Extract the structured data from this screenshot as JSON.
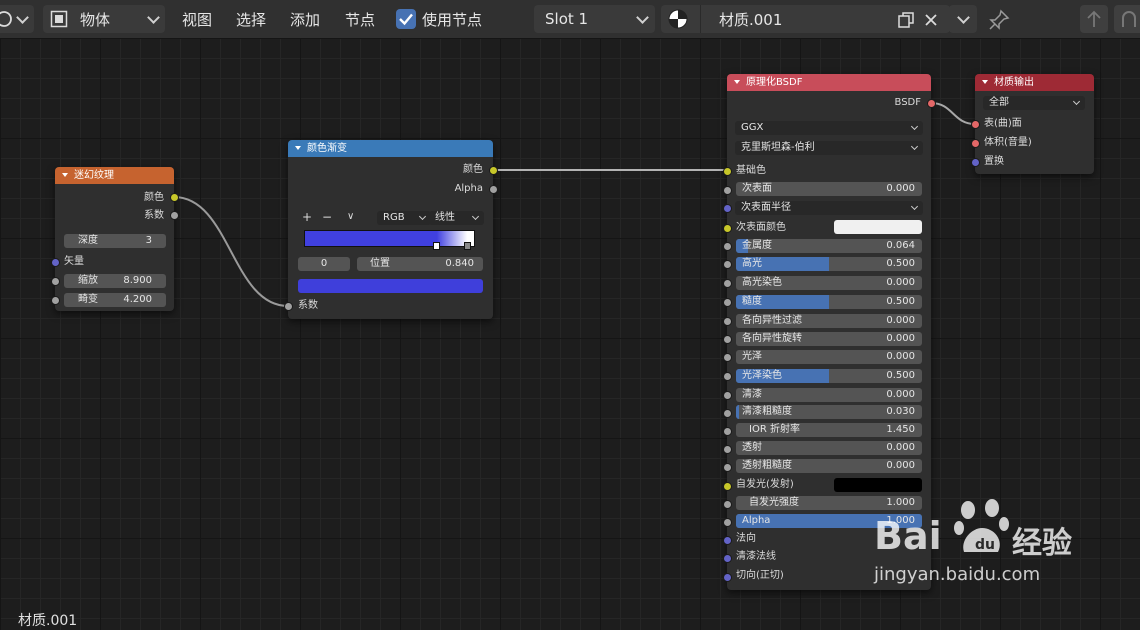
{
  "header": {
    "object_mode": "物体",
    "menus": [
      "视图",
      "选择",
      "添加",
      "节点"
    ],
    "use_nodes_label": "使用节点",
    "use_nodes_checked": true,
    "slot": "Slot 1",
    "material_name": "材质.001"
  },
  "nodes": {
    "magic": {
      "title": "迷幻纹理",
      "header_color": "#c6632f",
      "outputs": [
        "颜色",
        "系数"
      ],
      "depth": {
        "label": "深度",
        "value": "3"
      },
      "vector_label": "矢量",
      "scale": {
        "label": "缩放",
        "value": "8.900"
      },
      "distortion": {
        "label": "畸变",
        "value": "4.200"
      }
    },
    "ramp": {
      "title": "颜色渐变",
      "header_color": "#3a7ab8",
      "outputs": [
        "颜色",
        "Alpha"
      ],
      "toolbar": {
        "add": "+",
        "remove": "−",
        "more": "∨"
      },
      "color_mode": "RGB",
      "interpolation": "线性",
      "ramp_colors": [
        "#4040e0",
        "#ffffff"
      ],
      "stop_positions": [
        0.78,
        0.96
      ],
      "active_index": "0",
      "position": {
        "label": "位置",
        "value": "0.840"
      },
      "active_color": "#3f3fdb",
      "input_label": "系数"
    },
    "bsdf": {
      "title": "原理化BSDF",
      "header_color": "#c84d5a",
      "output_label": "BSDF",
      "distribution": "GGX",
      "subsurface_method": "克里斯坦森-伯利",
      "base_color_label": "基础色",
      "fields": [
        {
          "label": "次表面",
          "value": "0.000",
          "fill": 0
        },
        {
          "label": "次表面半径",
          "value": "",
          "fill": 0
        },
        {
          "label": "次表面颜色",
          "value": "",
          "fill": 0
        },
        {
          "label": "金属度",
          "value": "0.064",
          "fill": 0.064
        },
        {
          "label": "高光",
          "value": "0.500",
          "fill": 0.5
        },
        {
          "label": "高光染色",
          "value": "0.000",
          "fill": 0
        },
        {
          "label": "糙度",
          "value": "0.500",
          "fill": 0.5
        },
        {
          "label": "各向异性过滤",
          "value": "0.000",
          "fill": 0
        },
        {
          "label": "各向异性旋转",
          "value": "0.000",
          "fill": 0
        },
        {
          "label": "光泽",
          "value": "0.000",
          "fill": 0
        },
        {
          "label": "光泽染色",
          "value": "0.500",
          "fill": 0.5
        },
        {
          "label": "清漆",
          "value": "0.000",
          "fill": 0
        },
        {
          "label": "清漆粗糙度",
          "value": "0.030",
          "fill": 0.03
        },
        {
          "label": "IOR 折射率",
          "value": "1.450",
          "fill": 0
        },
        {
          "label": "透射",
          "value": "0.000",
          "fill": 0
        },
        {
          "label": "透射粗糙度",
          "value": "0.000",
          "fill": 0
        },
        {
          "label": "自发光(发射)",
          "value": "",
          "fill": 0
        },
        {
          "label": "自发光强度",
          "value": "1.000",
          "fill": 0
        },
        {
          "label": "Alpha",
          "value": "1.000",
          "fill": 1
        },
        {
          "label": "法向",
          "value": "",
          "fill": 0
        },
        {
          "label": "清漆法线",
          "value": "",
          "fill": 0
        },
        {
          "label": "切向(正切)",
          "value": "",
          "fill": 0
        }
      ],
      "subsurface_color": "#f0f0f0",
      "emission_color": "#000000"
    },
    "output": {
      "title": "材质输出",
      "header_color": "#9e2a35",
      "target": "全部",
      "inputs": [
        "表(曲)面",
        "体积(音量)",
        "置换"
      ]
    }
  },
  "watermark": {
    "brand_left": "Bai",
    "brand_right": "经验",
    "url": "jingyan.baidu.com"
  },
  "footer_text": "材质.001",
  "colors": {
    "editor_bg": "#1d1d1d",
    "node_body": "#2f2f2f",
    "field_bg": "#545454",
    "accent_blue": "#4772b3",
    "socket_yellow": "#c7c729",
    "socket_grey": "#a1a1a1",
    "socket_purple": "#6363c7",
    "socket_red": "#e36767"
  }
}
